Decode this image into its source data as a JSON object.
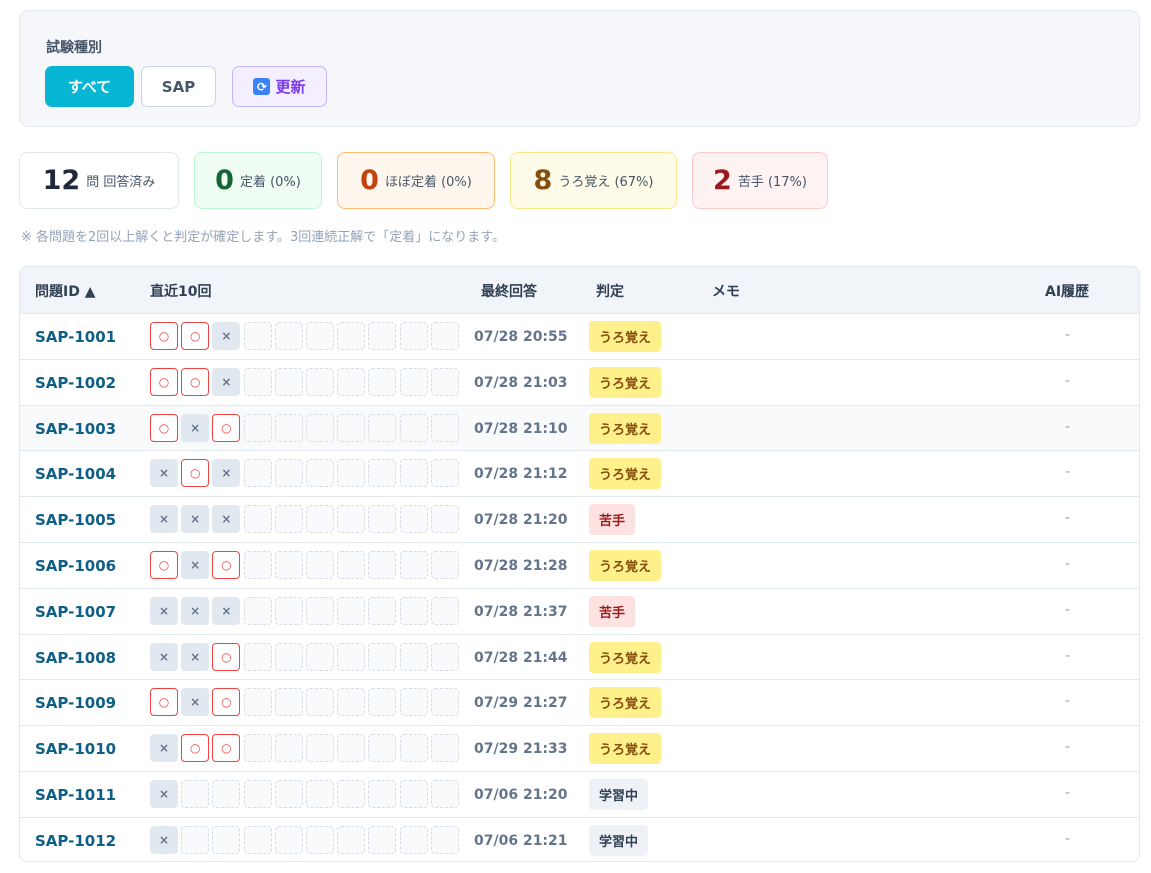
{
  "filter": {
    "label": "試験種別",
    "buttons": {
      "all": "すべて",
      "sap": "SAP",
      "refresh": "更新"
    },
    "refresh_icon": "refresh-icon"
  },
  "stats": {
    "total": {
      "num": "12",
      "label": "問 回答済み"
    },
    "fixed": {
      "num": "0",
      "label": "定着 (0%)"
    },
    "almost": {
      "num": "0",
      "label": "ほぼ定着 (0%)"
    },
    "vague": {
      "num": "8",
      "label": "うろ覚え (67%)"
    },
    "weak": {
      "num": "2",
      "label": "苦手 (17%)"
    }
  },
  "note": "※ 各問題を2回以上解くと判定が確定します。3回連続正解で「定着」になります。",
  "table": {
    "headers": {
      "id": "問題ID ▲",
      "recent": "直近10回",
      "last": "最終回答",
      "judge": "判定",
      "memo": "メモ",
      "ai": "AI履歴"
    },
    "marks": {
      "ok": "○",
      "ng": "×"
    },
    "rows": [
      {
        "id": "SAP-1001",
        "recent": [
          "ok",
          "ok",
          "ng"
        ],
        "last": "07/28 20:55",
        "judge": "うろ覚え",
        "kind": "vague",
        "ai": "-"
      },
      {
        "id": "SAP-1002",
        "recent": [
          "ok",
          "ok",
          "ng"
        ],
        "last": "07/28 21:03",
        "judge": "うろ覚え",
        "kind": "vague",
        "ai": "-"
      },
      {
        "id": "SAP-1003",
        "recent": [
          "ok",
          "ng",
          "ok"
        ],
        "last": "07/28 21:10",
        "judge": "うろ覚え",
        "kind": "vague",
        "ai": "-"
      },
      {
        "id": "SAP-1004",
        "recent": [
          "ng",
          "ok",
          "ng"
        ],
        "last": "07/28 21:12",
        "judge": "うろ覚え",
        "kind": "vague",
        "ai": "-"
      },
      {
        "id": "SAP-1005",
        "recent": [
          "ng",
          "ng",
          "ng"
        ],
        "last": "07/28 21:20",
        "judge": "苦手",
        "kind": "weak",
        "ai": "-"
      },
      {
        "id": "SAP-1006",
        "recent": [
          "ok",
          "ng",
          "ok"
        ],
        "last": "07/28 21:28",
        "judge": "うろ覚え",
        "kind": "vague",
        "ai": "-"
      },
      {
        "id": "SAP-1007",
        "recent": [
          "ng",
          "ng",
          "ng"
        ],
        "last": "07/28 21:37",
        "judge": "苦手",
        "kind": "weak",
        "ai": "-"
      },
      {
        "id": "SAP-1008",
        "recent": [
          "ng",
          "ng",
          "ok"
        ],
        "last": "07/28 21:44",
        "judge": "うろ覚え",
        "kind": "vague",
        "ai": "-"
      },
      {
        "id": "SAP-1009",
        "recent": [
          "ok",
          "ng",
          "ok"
        ],
        "last": "07/29 21:27",
        "judge": "うろ覚え",
        "kind": "vague",
        "ai": "-"
      },
      {
        "id": "SAP-1010",
        "recent": [
          "ng",
          "ok",
          "ok"
        ],
        "last": "07/29 21:33",
        "judge": "うろ覚え",
        "kind": "vague",
        "ai": "-"
      },
      {
        "id": "SAP-1011",
        "recent": [
          "ng"
        ],
        "last": "07/06 21:20",
        "judge": "学習中",
        "kind": "learn",
        "ai": "-"
      },
      {
        "id": "SAP-1012",
        "recent": [
          "ng"
        ],
        "last": "07/06 21:21",
        "judge": "学習中",
        "kind": "learn",
        "ai": "-"
      }
    ]
  }
}
